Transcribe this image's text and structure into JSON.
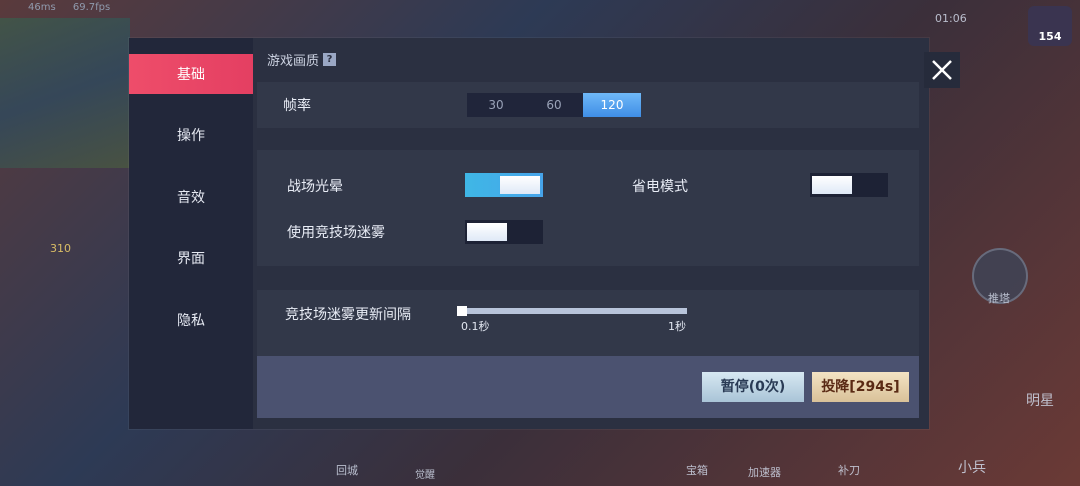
{
  "hud": {
    "ping": "46ms",
    "fps": "69.7fps",
    "timer": "01:06",
    "coins": "154",
    "gold": "310",
    "labels": {
      "recall": "回城",
      "awaken": "觉醒",
      "chest": "宝箱",
      "accelerator": "加速器",
      "last_hit": "补刀",
      "minion": "小兵",
      "push": "推塔",
      "star": "明星"
    }
  },
  "sidebar": {
    "items": [
      {
        "label": "基础",
        "active": true
      },
      {
        "label": "操作",
        "active": false
      },
      {
        "label": "音效",
        "active": false
      },
      {
        "label": "界面",
        "active": false
      },
      {
        "label": "隐私",
        "active": false
      }
    ]
  },
  "settings": {
    "section_title": "游戏画质",
    "help_icon": "help-icon",
    "framerate": {
      "label": "帧率",
      "options": [
        "30",
        "60",
        "120"
      ],
      "selected": "120"
    },
    "toggles": [
      {
        "label": "战场光晕",
        "on": true
      },
      {
        "label": "省电模式",
        "on": false
      },
      {
        "label": "使用竞技场迷雾",
        "on": false
      }
    ],
    "fog_interval": {
      "label": "竞技场迷雾更新间隔",
      "min_label": "0.1秒",
      "max_label": "1秒",
      "value": 0.1
    }
  },
  "footer": {
    "pause_label": "暂停(0次)",
    "surrender_label": "投降[294s]"
  },
  "colors": {
    "accent_active": "#ee4d6a",
    "toggle_on": "#3fb7e6",
    "segment_selected": "#4f9ef0"
  }
}
